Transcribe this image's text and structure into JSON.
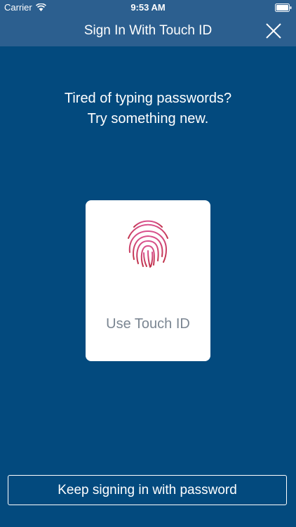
{
  "status_bar": {
    "carrier": "Carrier",
    "time": "9:53 AM",
    "wifi_icon": "wifi-icon",
    "battery_icon": "battery-icon"
  },
  "nav": {
    "title": "Sign In With Touch ID",
    "close_icon": "close-icon"
  },
  "prompt": {
    "line1": "Tired of typing passwords?",
    "line2": "Try something new."
  },
  "touch_card": {
    "icon": "fingerprint-icon",
    "label": "Use Touch ID"
  },
  "password_button": {
    "label": "Keep signing in with password"
  },
  "colors": {
    "background": "#034a7e",
    "header": "#2c5f8f",
    "card": "#ffffff",
    "card_label": "#7b8692",
    "fingerprint_gradient": [
      "#d9538f",
      "#c0324a"
    ]
  }
}
